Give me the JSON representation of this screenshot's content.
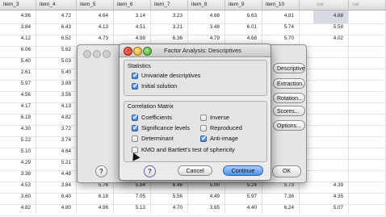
{
  "sheet": {
    "headers": [
      "item_3",
      "item_4",
      "item_5",
      "item_6",
      "item_7",
      "item_8",
      "item_9",
      "item_10",
      "var",
      "var"
    ],
    "rows": [
      [
        "4.96",
        "4.72",
        "4.64",
        "3.14",
        "3.23",
        "4.68",
        "6.63",
        "4.81",
        "4.68",
        ""
      ],
      [
        "3.84",
        "6.43",
        "4.13",
        "4.51",
        "3.21",
        "3.48",
        "6.01",
        "5.74",
        "5.58",
        ""
      ],
      [
        "4.12",
        "6.52",
        "4.73",
        "4.99",
        "6.36",
        "4.79",
        "4.68",
        "5.70",
        "4.02",
        ""
      ],
      [
        "6.06",
        "5.62",
        "",
        "",
        "",
        "",
        "",
        "",
        "",
        ""
      ],
      [
        "5.40",
        "5.03",
        "",
        "",
        "",
        "",
        "",
        "",
        "",
        ""
      ],
      [
        "2.61",
        "5.40",
        "",
        "",
        "",
        "",
        "",
        "",
        "",
        ""
      ],
      [
        "5.97",
        "3.89",
        "",
        "",
        "",
        "",
        "",
        "",
        "",
        ""
      ],
      [
        "4.56",
        "3.56",
        "",
        "",
        "",
        "",
        "",
        "",
        "",
        ""
      ],
      [
        "4.17",
        "4.13",
        "",
        "",
        "",
        "",
        "",
        "",
        "",
        ""
      ],
      [
        "6.19",
        "4.82",
        "",
        "",
        "",
        "",
        "",
        "",
        "",
        ""
      ],
      [
        "4.30",
        "3.72",
        "",
        "",
        "",
        "",
        "",
        "",
        "",
        ""
      ],
      [
        "5.22",
        "3.74",
        "",
        "",
        "",
        "",
        "",
        "",
        "",
        ""
      ],
      [
        "5.10",
        "4.64",
        "",
        "",
        "",
        "",
        "",
        "",
        "",
        ""
      ],
      [
        "4.29",
        "5.21",
        "",
        "",
        "",
        "",
        "",
        "",
        "",
        ""
      ],
      [
        "3.38",
        "4.48",
        "",
        "",
        "",
        "",
        "",
        "",
        "",
        ""
      ],
      [
        "4.53",
        "3.84",
        "5.76",
        "5.84",
        "6.46",
        "5.00",
        "5.24",
        "5.73",
        "4.39",
        ""
      ],
      [
        "3.60",
        "6.40",
        "6.18",
        "7.05",
        "5.56",
        "4.49",
        "5.97",
        "7.36",
        "4.35",
        ""
      ],
      [
        "4.82",
        "4.80",
        "4.96",
        "5.13",
        "4.70",
        "3.65",
        "4.40",
        "6.24",
        "5.07",
        ""
      ]
    ]
  },
  "back_dialog": {
    "buttons": [
      "Descriptives...",
      "Extraction...",
      "Rotation...",
      "Scores...",
      "Options..."
    ],
    "ok_label": "OK",
    "help_label": "?"
  },
  "dialog": {
    "title": "Factor Analysis: Descriptives",
    "statistics": {
      "label": "Statistics",
      "items": [
        {
          "label": "Univariate descriptives",
          "checked": true
        },
        {
          "label": "Initial solution",
          "checked": true
        }
      ]
    },
    "correlation": {
      "label": "Correlation Matrix",
      "items": [
        {
          "label": "Coefficients",
          "checked": true
        },
        {
          "label": "Inverse",
          "checked": false
        },
        {
          "label": "Significance levels",
          "checked": true
        },
        {
          "label": "Reproduced",
          "checked": false
        },
        {
          "label": "Determinant",
          "checked": false
        },
        {
          "label": "Anti-image",
          "checked": true
        },
        {
          "label": "KMO and Bartlett's test of sphericity",
          "checked": false
        }
      ]
    },
    "help_label": "?",
    "cancel_label": "Cancel",
    "continue_label": "Continue"
  }
}
